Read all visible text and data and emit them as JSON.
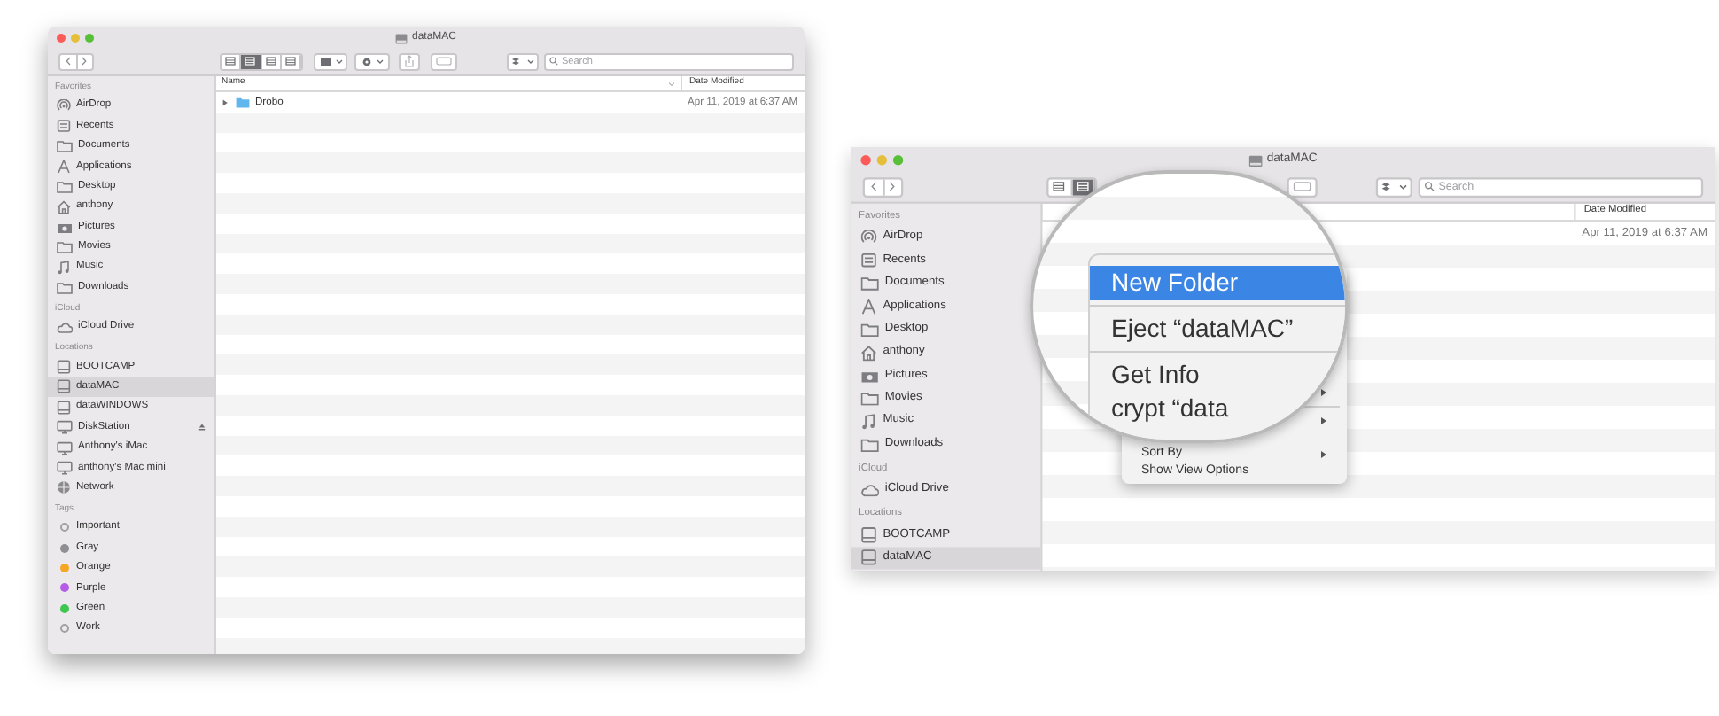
{
  "windows": [
    {
      "title": "dataMAC",
      "view_modes": [
        {
          "selected": false
        },
        {
          "selected": true
        },
        {
          "selected": false
        },
        {
          "selected": false
        }
      ],
      "tools": [
        {
          "kind": "group"
        },
        {
          "kind": "action"
        },
        {
          "kind": "share"
        },
        {
          "kind": "tag"
        }
      ],
      "search": {
        "placeholder": "Search"
      },
      "sidebar": [
        {
          "heading": "Favorites",
          "items": [
            {
              "label": "AirDrop",
              "kind": "airdrop",
              "selected": false
            },
            {
              "label": "Recents",
              "kind": "recents",
              "selected": false
            },
            {
              "label": "Documents",
              "kind": "folder",
              "selected": false
            },
            {
              "label": "Applications",
              "kind": "apps",
              "selected": false
            },
            {
              "label": "Desktop",
              "kind": "folder",
              "selected": false
            },
            {
              "label": "anthony",
              "kind": "home",
              "selected": false
            },
            {
              "label": "Pictures",
              "kind": "pictures",
              "selected": false
            },
            {
              "label": "Movies",
              "kind": "folder",
              "selected": false
            },
            {
              "label": "Music",
              "kind": "music",
              "selected": false
            },
            {
              "label": "Downloads",
              "kind": "folder",
              "selected": false
            }
          ]
        },
        {
          "heading": "iCloud",
          "items": [
            {
              "label": "iCloud Drive",
              "kind": "cloud",
              "selected": false
            }
          ]
        },
        {
          "heading": "Locations",
          "items": [
            {
              "label": "BOOTCAMP",
              "kind": "drive",
              "selected": false,
              "ejectable": false
            },
            {
              "label": "dataMAC",
              "kind": "drive",
              "selected": true,
              "ejectable": false
            },
            {
              "label": "dataWINDOWS",
              "kind": "drive",
              "selected": false,
              "ejectable": false
            },
            {
              "label": "DiskStation",
              "kind": "display",
              "selected": false,
              "ejectable": true
            },
            {
              "label": "Anthony's iMac",
              "kind": "display",
              "selected": false,
              "ejectable": false
            },
            {
              "label": "anthony's Mac mini",
              "kind": "display",
              "selected": false,
              "ejectable": false
            },
            {
              "label": "Network",
              "kind": "globe",
              "selected": false,
              "ejectable": false
            }
          ]
        },
        {
          "heading": "Tags",
          "items": [
            {
              "label": "Important",
              "kind": "tag",
              "selected": false
            },
            {
              "label": "Gray",
              "kind": "tag",
              "color": "#8e8e93",
              "selected": false
            },
            {
              "label": "Orange",
              "kind": "tag",
              "color": "#f5a623",
              "selected": false
            },
            {
              "label": "Purple",
              "kind": "tag",
              "color": "#b45ce6",
              "selected": false
            },
            {
              "label": "Green",
              "kind": "tag",
              "color": "#3ec74f",
              "selected": false
            },
            {
              "label": "Work",
              "kind": "tag",
              "selected": false
            }
          ]
        }
      ],
      "columns": [
        "Name",
        "Date Modified"
      ],
      "rows": [
        {
          "name": "Drobo",
          "date": "Apr 11, 2019 at 6:37 AM",
          "expanded": false
        }
      ]
    },
    {
      "title": "dataMAC",
      "view_modes": [
        {
          "selected": false
        },
        {
          "selected": true
        }
      ],
      "tools": [
        {
          "kind": "tag"
        }
      ],
      "search": {
        "placeholder": "Search"
      },
      "sidebar": [
        {
          "heading": "Favorites",
          "items": [
            {
              "label": "AirDrop",
              "kind": "airdrop",
              "selected": false
            },
            {
              "label": "Recents",
              "kind": "recents",
              "selected": false
            },
            {
              "label": "Documents",
              "kind": "folder",
              "selected": false
            },
            {
              "label": "Applications",
              "kind": "apps",
              "selected": false
            },
            {
              "label": "Desktop",
              "kind": "folder",
              "selected": false
            },
            {
              "label": "anthony",
              "kind": "home",
              "selected": false
            },
            {
              "label": "Pictures",
              "kind": "pictures",
              "selected": false
            },
            {
              "label": "Movies",
              "kind": "folder",
              "selected": false
            },
            {
              "label": "Music",
              "kind": "music",
              "selected": false
            },
            {
              "label": "Downloads",
              "kind": "folder",
              "selected": false
            }
          ]
        },
        {
          "heading": "iCloud",
          "items": [
            {
              "label": "iCloud Drive",
              "kind": "cloud",
              "selected": false
            }
          ]
        },
        {
          "heading": "Locations",
          "items": [
            {
              "label": "BOOTCAMP",
              "kind": "drive",
              "selected": false,
              "ejectable": false
            },
            {
              "label": "dataMAC",
              "kind": "drive",
              "selected": true,
              "ejectable": false
            }
          ]
        }
      ],
      "columns": [
        "Date Modified"
      ],
      "rows": [
        {
          "date": "Apr 11, 2019 at 6:37 AM"
        }
      ]
    }
  ],
  "context_menu": [
    {
      "submenu": true,
      "separator_before": false
    },
    {
      "submenu": true,
      "separator_before": true
    },
    {
      "label": "Sort By",
      "submenu": true,
      "separator_before": false
    },
    {
      "label": "Show View Options",
      "submenu": false,
      "separator_before": false
    }
  ],
  "magnifier": {
    "menu": [
      {
        "kind": "item",
        "label": "New Folder",
        "selected": true
      },
      {
        "kind": "separator"
      },
      {
        "kind": "item",
        "label": "Eject “dataMAC”",
        "selected": false
      },
      {
        "kind": "separator"
      },
      {
        "kind": "item",
        "label": "Get Info",
        "selected": false
      },
      {
        "kind": "item",
        "label": "crypt “data",
        "selected": false
      }
    ]
  }
}
